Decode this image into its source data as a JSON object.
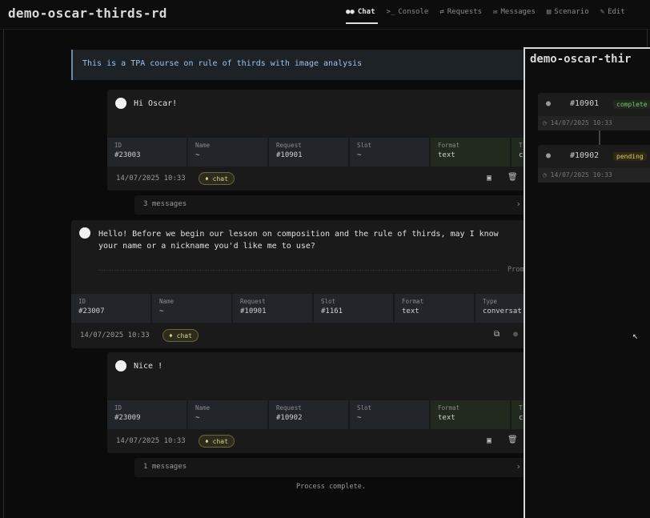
{
  "app": {
    "title": "demo-oscar-thirds-rd"
  },
  "nav": {
    "items": [
      {
        "label": "Chat",
        "icon": "users-icon",
        "active": true
      },
      {
        "label": "Console",
        "icon": "terminal-icon"
      },
      {
        "label": "Requests",
        "icon": "swap-icon"
      },
      {
        "label": "Messages",
        "icon": "envelope-icon"
      },
      {
        "label": "Scenario",
        "icon": "film-icon"
      },
      {
        "label": "Edit",
        "icon": "pencil-icon"
      }
    ]
  },
  "banner": {
    "text": "This is a TPA course on rule of thirds with image analysis"
  },
  "messages": [
    {
      "text": "Hi Oscar!",
      "meta": [
        {
          "label": "ID",
          "value": "#23003"
        },
        {
          "label": "Name",
          "value": "~"
        },
        {
          "label": "Request",
          "value": "#10901"
        },
        {
          "label": "Slot",
          "value": "~"
        },
        {
          "label": "Format",
          "value": "text"
        },
        {
          "label": "T",
          "value": "c"
        }
      ],
      "timestamp": "14/07/2025 10:33",
      "tag": "chat",
      "count": "3 messages"
    },
    {
      "text_line1": "Hello! Before we begin our lesson on composition and the rule of thirds, may I know",
      "text_line2": "your name or a nickname you'd like me to use?",
      "prompt_label": "Prom",
      "meta": [
        {
          "label": "ID",
          "value": "#23007"
        },
        {
          "label": "Name",
          "value": "~"
        },
        {
          "label": "Request",
          "value": "#10901"
        },
        {
          "label": "Slot",
          "value": "#1161"
        },
        {
          "label": "Format",
          "value": "text"
        },
        {
          "label": "Type",
          "value": "conversat"
        }
      ],
      "timestamp": "14/07/2025 10:33",
      "tag": "chat"
    },
    {
      "text": "Nice !",
      "meta": [
        {
          "label": "ID",
          "value": "#23009"
        },
        {
          "label": "Name",
          "value": "~"
        },
        {
          "label": "Request",
          "value": "#10902"
        },
        {
          "label": "Slot",
          "value": "~"
        },
        {
          "label": "Format",
          "value": "text"
        },
        {
          "label": "T",
          "value": "c"
        }
      ],
      "timestamp": "14/07/2025 10:33",
      "tag": "chat",
      "count": "1 messages"
    }
  ],
  "status": "Process complete.",
  "panel": {
    "title": "demo-oscar-thir",
    "requests": [
      {
        "id": "#10901",
        "status": "complete",
        "timestamp": "14/07/2025 10:33"
      },
      {
        "id": "#10902",
        "status": "pending",
        "timestamp": "14/07/2025 10:33"
      }
    ]
  },
  "colors": {
    "accent": "#6f88a6",
    "tag": "#d9d48a",
    "complete": "#7fbf73",
    "pending": "#e3c963"
  }
}
